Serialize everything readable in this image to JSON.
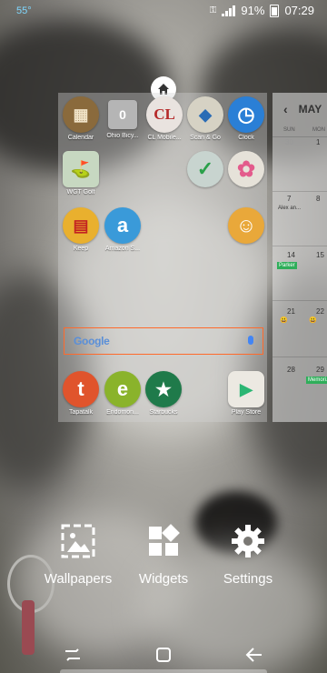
{
  "status": {
    "temperature": "55°",
    "battery": "91%",
    "time": "07:29"
  },
  "home_page": {
    "rows": [
      [
        {
          "label": "Calendar",
          "icon": "calendar-icon",
          "glyph": "▦",
          "color": "#8a6a3c"
        },
        {
          "label": "Ohio Bicy...",
          "icon": "folder-icon",
          "glyph": "0",
          "color": "#b5b5b5"
        },
        {
          "label": "CL Mobile...",
          "icon": "cl-mobile-icon",
          "glyph": "CL",
          "color": "#e9e3df"
        },
        {
          "label": "Scan & Go",
          "icon": "scan-go-icon",
          "glyph": "◆",
          "color": "#d6d2c4"
        },
        {
          "label": "Clock",
          "icon": "clock-icon",
          "glyph": "◷",
          "color": "#2a7fd6"
        }
      ],
      [
        {
          "label": "WGT Golf",
          "icon": "wgt-golf-icon",
          "glyph": "⛳",
          "color": "#c7d8c1"
        },
        {
          "label": "",
          "icon": "check-app-icon",
          "glyph": "✓",
          "color": "#c8d4cf"
        },
        {
          "label": "",
          "icon": "photos-icon",
          "glyph": "✿",
          "color": "#e6e2d9"
        }
      ],
      [
        {
          "label": "Keep",
          "icon": "keep-icon",
          "glyph": "▤",
          "color": "#e9b02e"
        },
        {
          "label": "Amazon S...",
          "icon": "amazon-icon",
          "glyph": "a",
          "color": "#3a9ad9"
        },
        {
          "label": "",
          "icon": "contacts-icon",
          "glyph": "☺",
          "color": "#e9a83a"
        }
      ],
      [
        {
          "label": "Tapatalk",
          "icon": "tapatalk-icon",
          "glyph": "t",
          "color": "#e0542c"
        },
        {
          "label": "Endomon...",
          "icon": "endomondo-icon",
          "glyph": "e",
          "color": "#8ab32b"
        },
        {
          "label": "Starbucks",
          "icon": "starbucks-icon",
          "glyph": "★",
          "color": "#1f7a4a"
        },
        {
          "label": "Play Store",
          "icon": "play-store-icon",
          "glyph": "▶",
          "color": "#ece9e2"
        }
      ]
    ],
    "search": {
      "logo": "Google"
    }
  },
  "calendar_peek": {
    "month": "MAY",
    "weekdays": [
      "SUN",
      "MON"
    ],
    "dates": [
      "30",
      "1",
      "7",
      "8",
      "14",
      "15",
      "21",
      "22",
      "28",
      "29"
    ],
    "events": {
      "alex": "Alex an...",
      "parker": "Parker",
      "memorial": "Memori..."
    }
  },
  "menu": [
    {
      "label": "Wallpapers",
      "icon": "wallpapers-icon"
    },
    {
      "label": "Widgets",
      "icon": "widgets-icon"
    },
    {
      "label": "Settings",
      "icon": "settings-icon"
    }
  ]
}
